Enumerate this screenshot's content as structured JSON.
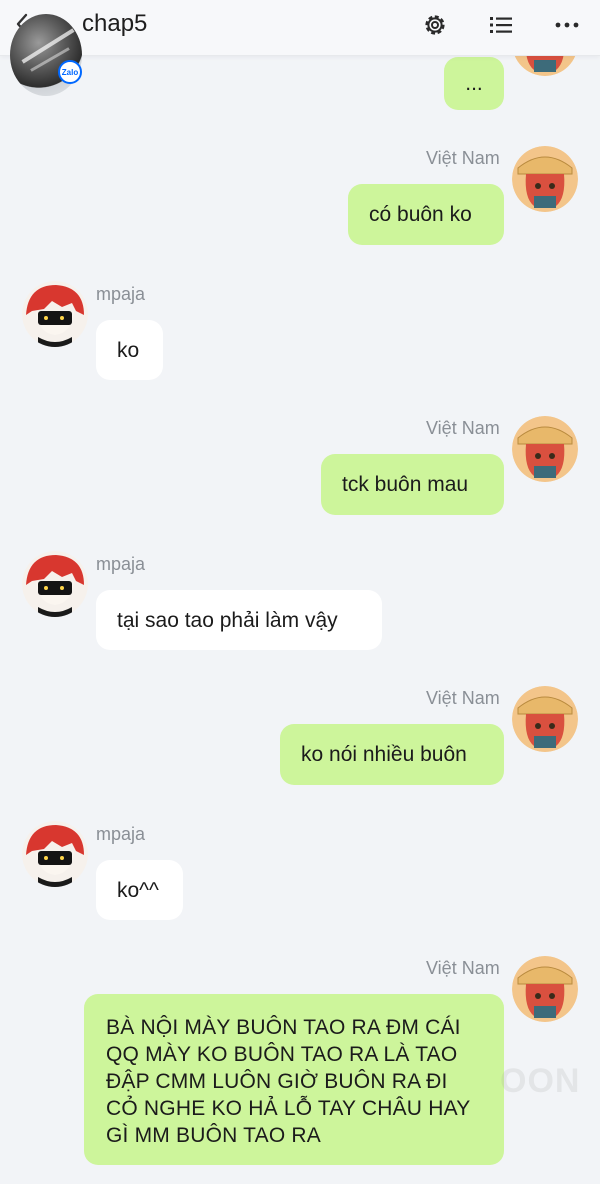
{
  "header": {
    "title": "chap5",
    "badge_label": "Zalo"
  },
  "messages": [
    {
      "direction": "out",
      "sender": "",
      "text": "..."
    },
    {
      "direction": "out",
      "sender": "Việt Nam",
      "text": "có buôn ko"
    },
    {
      "direction": "in",
      "sender": "mpaja",
      "text": "ko"
    },
    {
      "direction": "out",
      "sender": "Việt Nam",
      "text": "tck buôn mau"
    },
    {
      "direction": "in",
      "sender": "mpaja",
      "text": "tại sao tao phải làm vậy"
    },
    {
      "direction": "out",
      "sender": "Việt Nam",
      "text": "ko nói nhiều buôn"
    },
    {
      "direction": "in",
      "sender": "mpaja",
      "text": "ko^^"
    },
    {
      "direction": "out",
      "sender": "Việt Nam",
      "text": "BÀ NỘI MÀY BUÔN TAO RA ĐM CÁI QQ MÀY KO BUÔN TAO RA LÀ TAO ĐẬP CMM LUÔN GIỜ BUÔN RA ĐI CỎ NGHE KO HẢ LỖ TAY CHÂU HAY GÌ MM BUÔN TAO RA"
    }
  ],
  "long_message_lines": [
    "BÀ NỘI MÀY BUÔN TAO RA ĐM CÁI",
    "QQ MÀY KO BUÔN TAO RA LÀ TAO",
    "ĐẬP CMM LUÔN GIỜ BUÔN RA ĐI",
    "CỎ NGHE KO HẢ LỖ TAY CHÂU HAY",
    "GÌ MM BUÔN TAO RA"
  ],
  "watermark": "OON",
  "colors": {
    "outgoing_bubble": "#cdf59b",
    "incoming_bubble": "#ffffff",
    "background": "#f2f4f7",
    "zalo_blue": "#0068ff"
  },
  "icons": [
    "back-arrow-icon",
    "gear-icon",
    "list-icon",
    "more-icon"
  ]
}
